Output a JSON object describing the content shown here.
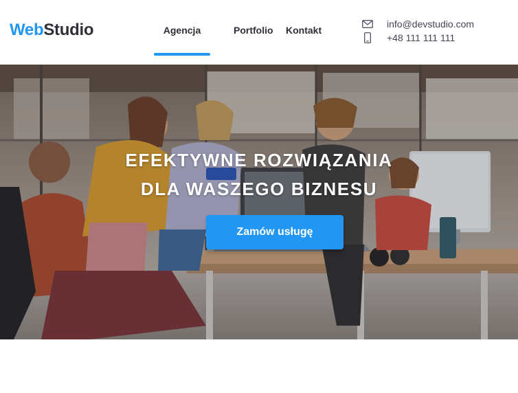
{
  "header": {
    "logo": {
      "accent": "Web",
      "rest": "Studio"
    },
    "nav": [
      {
        "label": "Agencja",
        "active": true
      },
      {
        "label": "Portfolio",
        "active": false
      },
      {
        "label": "Kontakt",
        "active": false
      }
    ],
    "contacts": {
      "email": {
        "icon": "envelope-icon",
        "text": "info@devstudio.com"
      },
      "phone": {
        "icon": "smartphone-icon",
        "text": "+48 111 111 111"
      }
    }
  },
  "hero": {
    "title_line1": "Efektywne rozwiązania",
    "title_line2": "dla waszego biznesu",
    "cta_label": "Zamów usługę",
    "background": "office-team-photo"
  },
  "colors": {
    "accent": "#2196f3",
    "text_dark": "#2f2f37",
    "text_secondary": "#434455",
    "white": "#ffffff"
  }
}
